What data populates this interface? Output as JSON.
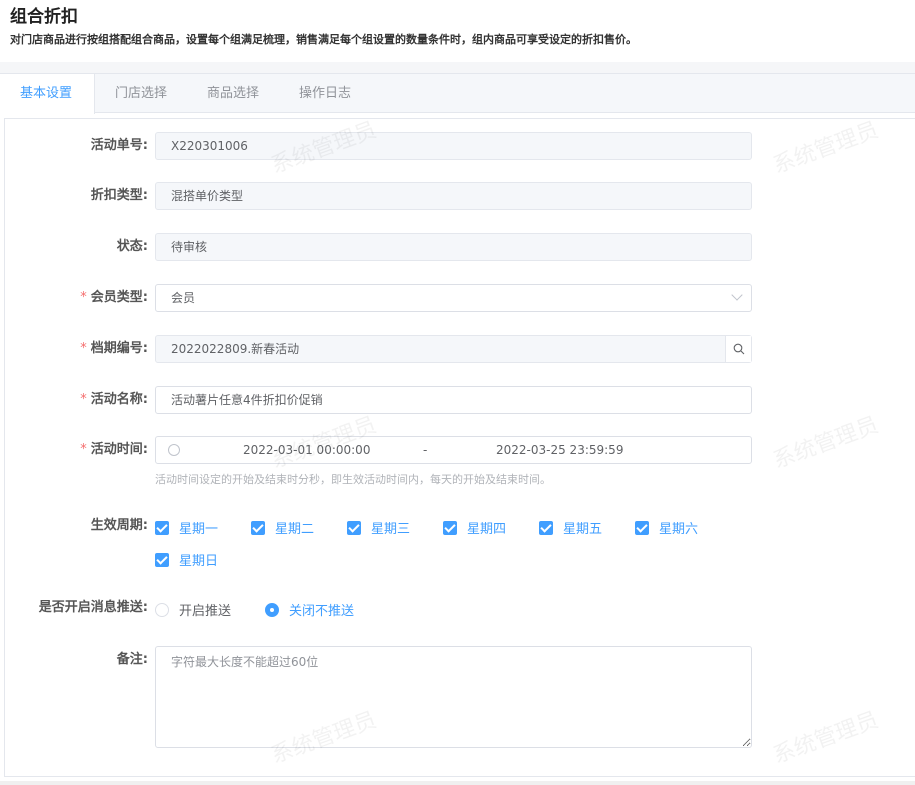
{
  "header": {
    "title": "组合折扣",
    "description": "对门店商品进行按组搭配组合商品，设置每个组满足梳理，销售满足每个组设置的数量条件时，组内商品可享受设定的折扣售价。"
  },
  "tabs": [
    {
      "label": "基本设置"
    },
    {
      "label": "门店选择"
    },
    {
      "label": "商品选择"
    },
    {
      "label": "操作日志"
    }
  ],
  "form": {
    "activity_no": {
      "label": "活动单号:",
      "value": "X220301006"
    },
    "discount_type": {
      "label": "折扣类型:",
      "value": "混搭单价类型"
    },
    "status": {
      "label": "状态:",
      "value": "待审核"
    },
    "member_type": {
      "label": "会员类型:",
      "value": "会员"
    },
    "period_no": {
      "label": "档期编号:",
      "value": "2022022809.新春活动"
    },
    "activity_name": {
      "label": "活动名称:",
      "value": "活动薯片任意4件折扣价促销"
    },
    "activity_time": {
      "label": "活动时间:",
      "start": "2022-03-01 00:00:00",
      "separator": "-",
      "end": "2022-03-25 23:59:59",
      "hint": "活动时间设定的开始及结束时分秒，即生效活动时间内，每天的开始及结束时间。"
    },
    "cycle": {
      "label": "生效周期:",
      "days": [
        {
          "label": "星期一",
          "checked": true
        },
        {
          "label": "星期二",
          "checked": true
        },
        {
          "label": "星期三",
          "checked": true
        },
        {
          "label": "星期四",
          "checked": true
        },
        {
          "label": "星期五",
          "checked": true
        },
        {
          "label": "星期六",
          "checked": true
        },
        {
          "label": "星期日",
          "checked": true
        }
      ]
    },
    "push": {
      "label": "是否开启消息推送:",
      "options": [
        {
          "label": "开启推送",
          "selected": false
        },
        {
          "label": "关闭不推送",
          "selected": true
        }
      ]
    },
    "remark": {
      "label": "备注:",
      "placeholder": "字符最大长度不能超过60位"
    }
  },
  "watermark": "系统管理员"
}
